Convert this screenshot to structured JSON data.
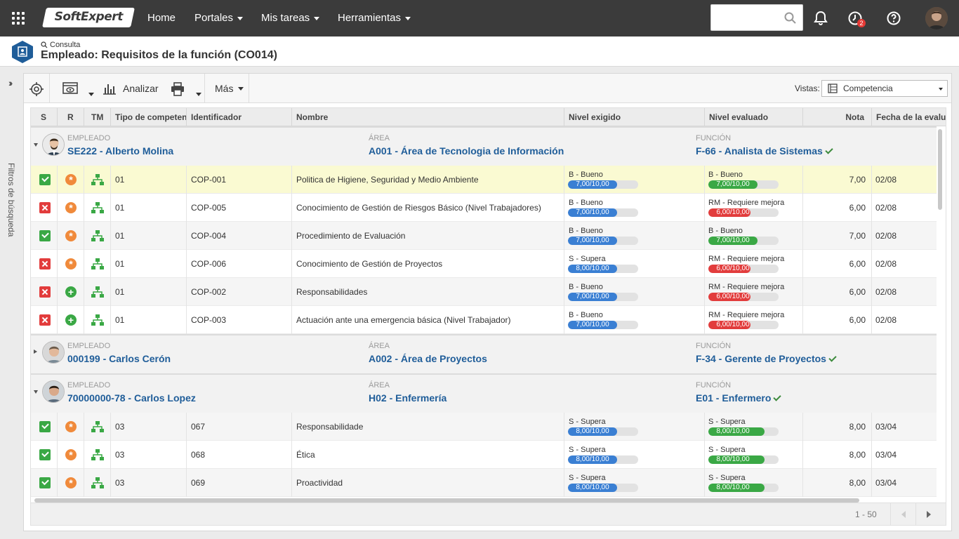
{
  "topbar": {
    "logo": "SoftExpert",
    "nav": [
      {
        "label": "Home",
        "has_caret": false
      },
      {
        "label": "Portales",
        "has_caret": true
      },
      {
        "label": "Mis tareas",
        "has_caret": true
      },
      {
        "label": "Herramientas",
        "has_caret": true
      }
    ],
    "search_placeholder": "",
    "tasks_badge": "2"
  },
  "header": {
    "subtitle": "Consulta",
    "title": "Empleado: Requisitos de la función (CO014)"
  },
  "side_filter": {
    "label": "Filtros de búsqueda"
  },
  "toolbar": {
    "analyze_label": "Analizar",
    "more_label": "Más",
    "views_label": "Vistas:",
    "views_value": "Competencia"
  },
  "columns": [
    "S",
    "R",
    "TM",
    "Tipo de competencia",
    "Identificador",
    "Nombre",
    "Nivel exigido",
    "Nivel evaluado",
    "Nota",
    "Fecha de la evaluación"
  ],
  "group_captions": {
    "employee": "EMPLEADO",
    "area": "ÁREA",
    "function": "FUNCIÓN"
  },
  "groups": [
    {
      "expanded": true,
      "employee": "SE222 - Alberto Molina",
      "area": "A001 - Área de Tecnologia de Información",
      "function": "F-66 - Analista de Sistemas",
      "rows": [
        {
          "s": "ok",
          "r": "ast",
          "tipo": "01",
          "id": "COP-001",
          "nombre": "Politica de Higiene, Seguridad y Medio Ambiente",
          "req_label": "B - Bueno",
          "req_text": "7,00/10,00",
          "req_value": 0.7,
          "eval_label": "B - Bueno",
          "eval_text": "7,00/10,00",
          "eval_value": 0.7,
          "eval_color": "green",
          "nota": "7,00",
          "fecha": "02/08",
          "selected": true
        },
        {
          "s": "bad",
          "r": "ast",
          "tipo": "01",
          "id": "COP-005",
          "nombre": "Conocimiento de Gestión de Riesgos Básico (Nivel Trabajadores)",
          "req_label": "B - Bueno",
          "req_text": "7,00/10,00",
          "req_value": 0.7,
          "eval_label": "RM - Requiere mejora",
          "eval_text": "6,00/10,00",
          "eval_value": 0.6,
          "eval_color": "red",
          "nota": "6,00",
          "fecha": "02/08"
        },
        {
          "s": "ok",
          "r": "ast",
          "tipo": "01",
          "id": "COP-004",
          "nombre": "Procedimiento de Evaluación",
          "req_label": "B - Bueno",
          "req_text": "7,00/10,00",
          "req_value": 0.7,
          "eval_label": "B - Bueno",
          "eval_text": "7,00/10,00",
          "eval_value": 0.7,
          "eval_color": "green",
          "nota": "7,00",
          "fecha": "02/08"
        },
        {
          "s": "bad",
          "r": "ast",
          "tipo": "01",
          "id": "COP-006",
          "nombre": "Conocimiento de Gestión de Proyectos",
          "req_label": "S - Supera",
          "req_text": "8,00/10,00",
          "req_value": 0.7,
          "eval_label": "RM - Requiere mejora",
          "eval_text": "6,00/10,00",
          "eval_value": 0.6,
          "eval_color": "red",
          "nota": "6,00",
          "fecha": "02/08"
        },
        {
          "s": "bad",
          "r": "plus",
          "tipo": "01",
          "id": "COP-002",
          "nombre": "Responsabilidades",
          "req_label": "B - Bueno",
          "req_text": "7,00/10,00",
          "req_value": 0.7,
          "eval_label": "RM - Requiere mejora",
          "eval_text": "6,00/10,00",
          "eval_value": 0.6,
          "eval_color": "red",
          "nota": "6,00",
          "fecha": "02/08"
        },
        {
          "s": "bad",
          "r": "plus",
          "tipo": "01",
          "id": "COP-003",
          "nombre": "Actuación ante una emergencia básica (Nivel Trabajador)",
          "req_label": "B - Bueno",
          "req_text": "7,00/10,00",
          "req_value": 0.7,
          "eval_label": "RM - Requiere mejora",
          "eval_text": "6,00/10,00",
          "eval_value": 0.6,
          "eval_color": "red",
          "nota": "6,00",
          "fecha": "02/08"
        }
      ]
    },
    {
      "expanded": false,
      "employee": "000199 - Carlos Cerón",
      "area": "A002 - Área de Proyectos",
      "function": "F-34 - Gerente de Proyectos",
      "rows": []
    },
    {
      "expanded": true,
      "employee": "70000000-78 - Carlos Lopez",
      "area": "H02 - Enfermería",
      "function": "E01 - Enfermero",
      "rows": [
        {
          "s": "ok",
          "r": "ast",
          "tipo": "03",
          "id": "067",
          "nombre": "Responsabilidade",
          "req_label": "S - Supera",
          "req_text": "8,00/10,00",
          "req_value": 0.7,
          "eval_label": "S - Supera",
          "eval_text": "8,00/10,00",
          "eval_value": 0.8,
          "eval_color": "green",
          "nota": "8,00",
          "fecha": "03/04"
        },
        {
          "s": "ok",
          "r": "ast",
          "tipo": "03",
          "id": "068",
          "nombre": "Ética",
          "req_label": "S - Supera",
          "req_text": "8,00/10,00",
          "req_value": 0.7,
          "eval_label": "S - Supera",
          "eval_text": "8,00/10,00",
          "eval_value": 0.8,
          "eval_color": "green",
          "nota": "8,00",
          "fecha": "03/04"
        },
        {
          "s": "ok",
          "r": "ast",
          "tipo": "03",
          "id": "069",
          "nombre": "Proactividad",
          "req_label": "S - Supera",
          "req_text": "8,00/10,00",
          "req_value": 0.7,
          "eval_label": "S - Supera",
          "eval_text": "8,00/10,00",
          "eval_value": 0.8,
          "eval_color": "green",
          "nota": "8,00",
          "fecha": "03/04"
        }
      ]
    }
  ],
  "pagination": {
    "range": "1 - 50"
  }
}
